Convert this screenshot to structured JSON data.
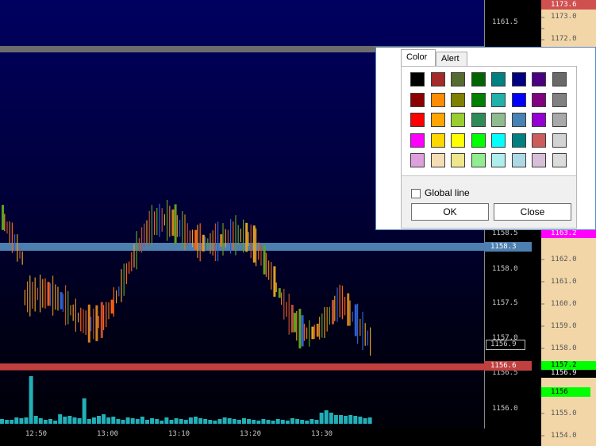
{
  "price_axis": {
    "labels": [
      "1161.5",
      "1158.5",
      "1158.0",
      "1157.5",
      "1157.0",
      "1156.5",
      "1156.0"
    ],
    "markers": {
      "level_upper": "1158.3",
      "last_price": "1156.9",
      "level_lower": "1156.6"
    }
  },
  "time_axis": {
    "labels": [
      "12:50",
      "13:00",
      "13:10",
      "13:20",
      "13:30"
    ]
  },
  "ladder": {
    "prices": [
      "1173.0",
      "1172.0",
      "1162.0",
      "1161.0",
      "1160.0",
      "1159.0",
      "1158.0",
      "1155.0",
      "1154.0"
    ],
    "markers": {
      "top_red": "1173.6",
      "magenta": "1163.2",
      "green": "1157.2",
      "current": "1156.9",
      "green_lower": "1156"
    }
  },
  "colors": {
    "level_upper": "#4d80b0",
    "level_lower": "#c04040",
    "ladder_bg": "#f2d6a8",
    "ladder_red": "#d05050",
    "ladder_magenta": "#ff00ff",
    "ladder_green": "#00ff00",
    "volume_bar": "#22b0b8"
  },
  "color_dialog": {
    "tabs": [
      "Color",
      "Alert"
    ],
    "active_tab": "Color",
    "palette": [
      [
        "#000000",
        "#a52a2a",
        "#556b2f",
        "#006400",
        "#008080",
        "#000080",
        "#4b0082",
        "#696969"
      ],
      [
        "#8b0000",
        "#ff8c00",
        "#808000",
        "#008000",
        "#20b2aa",
        "#0000ff",
        "#800080",
        "#808080"
      ],
      [
        "#ff0000",
        "#ffa500",
        "#9acd32",
        "#2e8b57",
        "#8fbc8f",
        "#4682b4",
        "#9400d3",
        "#a9a9a9"
      ],
      [
        "#ff00ff",
        "#ffd700",
        "#ffff00",
        "#00ff00",
        "#00ffff",
        "#008080",
        "#cd5c5c",
        "#d3d3d3"
      ],
      [
        "#dda0dd",
        "#f5deb3",
        "#f0e68c",
        "#90ee90",
        "#afeeee",
        "#add8e6",
        "#d8bfd8",
        "#dcdcdc"
      ]
    ],
    "global_line_label": "Global line",
    "global_line_checked": false,
    "ok_label": "OK",
    "close_label": "Close"
  }
}
